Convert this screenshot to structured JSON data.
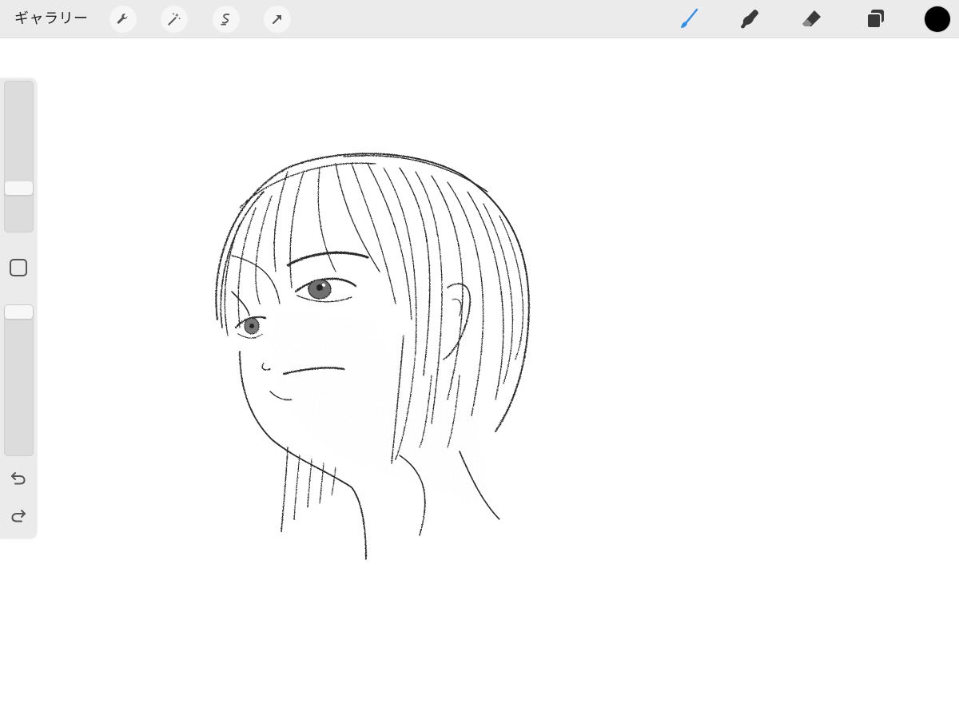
{
  "toolbar": {
    "gallery_label": "ギャラリー",
    "left_tools": [
      "wrench-icon",
      "magic-wand-icon",
      "selection-icon",
      "transform-arrow-icon"
    ],
    "right_tools": [
      "brush-icon",
      "smudge-icon",
      "eraser-icon",
      "layers-icon"
    ],
    "active_tool": "brush-icon",
    "active_color": "#2f8fe8",
    "current_color": "#000000"
  },
  "sidebar": {
    "brush_size": 0.27,
    "opacity": 1.0,
    "controls": [
      "modify-button",
      "undo-icon",
      "redo-icon"
    ]
  },
  "canvas": {
    "content": "pencil-sketch"
  }
}
